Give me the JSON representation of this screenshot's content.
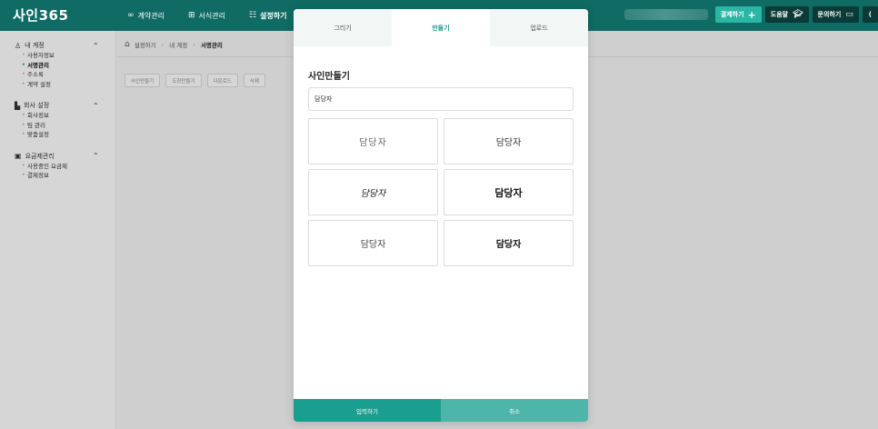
{
  "app": {
    "logo": "사인365"
  },
  "nav": {
    "items": [
      {
        "label": "계약관리",
        "icon": "link-icon"
      },
      {
        "label": "서식관리",
        "icon": "grid-icon"
      },
      {
        "label": "설정하기",
        "icon": "sliders-icon"
      }
    ]
  },
  "topbar": {
    "pay_label": "결제하기",
    "guide_label": "도움말",
    "inquiry_label": "문의하기",
    "extra_label": "("
  },
  "sidebar": {
    "groups": [
      {
        "title": "내 계정",
        "icon": "user-icon",
        "items": [
          "사용자정보",
          "서명관리",
          "주소록",
          "계약 설정"
        ]
      },
      {
        "title": "회사 설정",
        "icon": "building-icon",
        "items": [
          "회사정보",
          "팀 관리",
          "맞춤설정"
        ]
      },
      {
        "title": "요금제관리",
        "icon": "billing-icon",
        "items": [
          "사용중인 요금제",
          "결제정보"
        ]
      }
    ]
  },
  "breadcrumb": {
    "items": [
      "설정하기",
      "내 계정",
      "서명관리"
    ]
  },
  "actions": [
    "사인만들기",
    "도장만들기",
    "다운로드",
    "삭제"
  ],
  "modal": {
    "tabs": [
      "그리기",
      "만들기",
      "업로드"
    ],
    "active_tab": "만들기",
    "title": "사인만들기",
    "input_value": "담당자",
    "signatures": [
      "담당자",
      "담당자",
      "담당자",
      "담당자",
      "담당자",
      "담당자"
    ],
    "confirm_label": "입력하기",
    "cancel_label": "취소"
  },
  "colors": {
    "primary": "#1a9e8f",
    "topbar": "#0f6b63"
  }
}
